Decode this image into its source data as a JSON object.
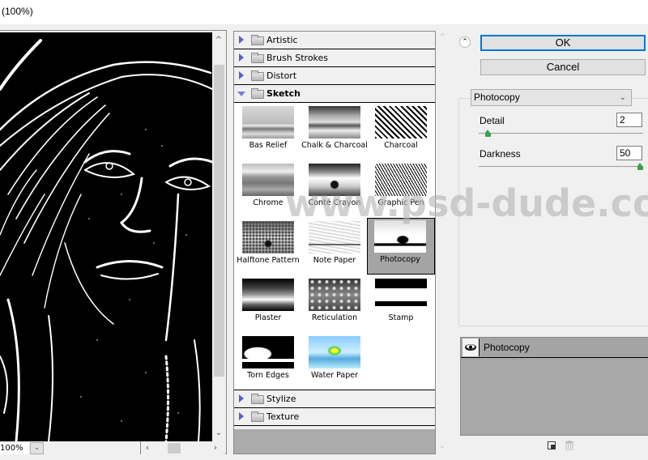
{
  "window": {
    "title": "(100%)"
  },
  "preview": {
    "zoom_value": "100%",
    "zoom_dropdown_icon": "chevron-down-icon",
    "scroll_up_icon": "chevron-up-icon",
    "scroll_down_icon": "chevron-down-icon",
    "scroll_left_icon": "chevron-left-icon",
    "scroll_right_icon": "chevron-right-icon"
  },
  "gallery": {
    "categories_top": [
      {
        "label": "Artistic",
        "expanded": false
      },
      {
        "label": "Brush Strokes",
        "expanded": false
      },
      {
        "label": "Distort",
        "expanded": false
      },
      {
        "label": "Sketch",
        "expanded": true
      }
    ],
    "sketch_filters": [
      {
        "label": "Bas Relief",
        "selected": false
      },
      {
        "label": "Chalk & Charcoal",
        "selected": false
      },
      {
        "label": "Charcoal",
        "selected": false
      },
      {
        "label": "Chrome",
        "selected": false
      },
      {
        "label": "Conté Crayon",
        "selected": false
      },
      {
        "label": "Graphic Pen",
        "selected": false
      },
      {
        "label": "Halftone Pattern",
        "selected": false
      },
      {
        "label": "Note Paper",
        "selected": false
      },
      {
        "label": "Photocopy",
        "selected": true
      },
      {
        "label": "Plaster",
        "selected": false
      },
      {
        "label": "Reticulation",
        "selected": false
      },
      {
        "label": "Stamp",
        "selected": false
      },
      {
        "label": "Torn Edges",
        "selected": false
      },
      {
        "label": "Water Paper",
        "selected": false
      }
    ],
    "categories_bottom": [
      {
        "label": "Stylize",
        "expanded": false
      },
      {
        "label": "Texture",
        "expanded": false
      }
    ]
  },
  "controls": {
    "collapse_icon": "double-chevron-up-icon",
    "ok_label": "OK",
    "cancel_label": "Cancel",
    "filter_select_value": "Photocopy",
    "params": [
      {
        "label": "Detail",
        "value": "2",
        "min": 1,
        "max": 24,
        "fraction": 0.04
      },
      {
        "label": "Darkness",
        "value": "50",
        "min": 1,
        "max": 50,
        "fraction": 1.0
      }
    ]
  },
  "effect_layers": {
    "layers": [
      {
        "name": "Photocopy",
        "visible": true
      }
    ],
    "new_layer_icon": "new-effect-layer-icon",
    "delete_icon": "trash-icon"
  },
  "watermark": "www.psd-dude.com",
  "colors": {
    "accent_focus": "#0078d7",
    "slider_knob": "#3aa04a",
    "selected_thumb_bg": "#a4a4a4",
    "disclosure_triangle": "#5b5bd6"
  }
}
